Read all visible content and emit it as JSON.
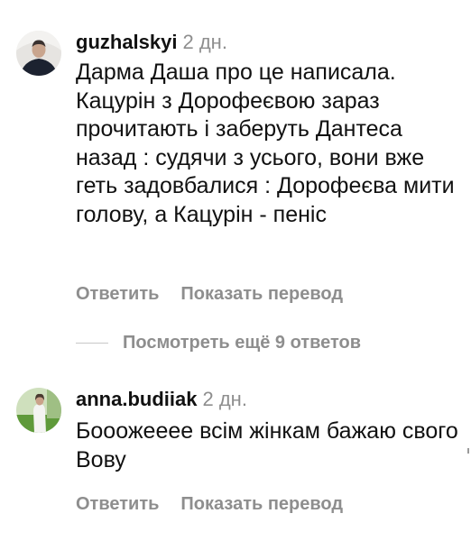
{
  "comments": [
    {
      "username": "guzhalskyi",
      "time": "2 дн.",
      "text": "Дарма Даша про це написала. Кацурін з Дорофеєвою зараз прочитають і заберуть Дантеса назад : судячи з усього, вони вже геть задовбалися : Дорофеєва мити голову, а Кацурін - пеніс",
      "reply_label": "Ответить",
      "translate_label": "Показать перевод"
    },
    {
      "username": "anna.budiiak",
      "time": "2 дн.",
      "text": "Бооожееее всім жінкам бажаю свого Вову",
      "reply_label": "Ответить",
      "translate_label": "Показать перевод"
    }
  ],
  "view_replies_label": "Посмотреть ещё 9 ответов",
  "colors": {
    "text": "#111111",
    "secondary": "#8e8e8e",
    "divider": "#c7c7c7",
    "background": "#ffffff"
  },
  "icons": {
    "avatar_1": "user-avatar-photo",
    "avatar_2": "user-avatar-photo"
  }
}
